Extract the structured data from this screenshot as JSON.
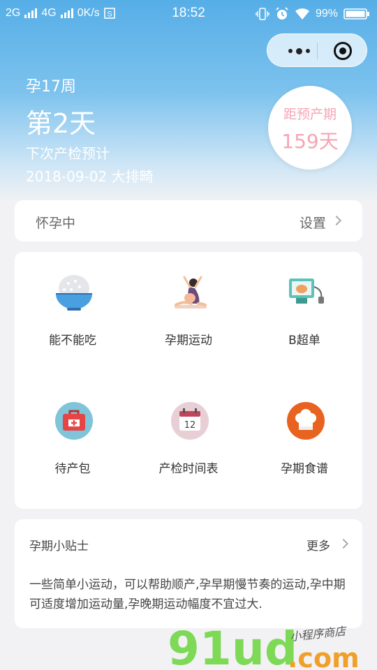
{
  "status_bar": {
    "network_1": "2G",
    "network_2": "4G",
    "speed": "0K/s",
    "time": "18:52",
    "battery": "99%",
    "icons": [
      "signal-icon",
      "data-saver-icon",
      "vibrate-icon",
      "alarm-icon",
      "wifi-icon",
      "battery-icon"
    ]
  },
  "mini_program_capsule": {
    "icons": [
      "more-dots-icon",
      "close-target-icon"
    ]
  },
  "pregnancy": {
    "week_label": "孕17周",
    "day_label": "第2天",
    "next_checkup_label": "下次产检预计",
    "next_checkup_date": "2018-09-02 大排畸"
  },
  "due_date": {
    "label": "距预产期",
    "days": "159天"
  },
  "status_row": {
    "label": "怀孕中",
    "action": "设置"
  },
  "features": [
    {
      "label": "能不能吃",
      "icon": "rice-bowl-icon"
    },
    {
      "label": "孕期运动",
      "icon": "yoga-icon"
    },
    {
      "label": "B超单",
      "icon": "ultrasound-icon"
    },
    {
      "label": "待产包",
      "icon": "first-aid-kit-icon"
    },
    {
      "label": "产检时间表",
      "icon": "calendar-icon",
      "calendar_day": "12"
    },
    {
      "label": "孕期食谱",
      "icon": "chef-hat-icon"
    }
  ],
  "tips": {
    "title": "孕期小贴士",
    "more": "更多",
    "content": "一些简单小运动，可以帮助顺产,孕早期慢节奏的运动,孕中期可适度增加运动量,孕晚期运动幅度不宜过大."
  },
  "watermark": {
    "text": "91ud.com",
    "subtitle": "小程序商店"
  },
  "colors": {
    "accent_blue": "#56aee7",
    "due_pink": "#f5a5b5",
    "teal": "#5ec2b8"
  }
}
